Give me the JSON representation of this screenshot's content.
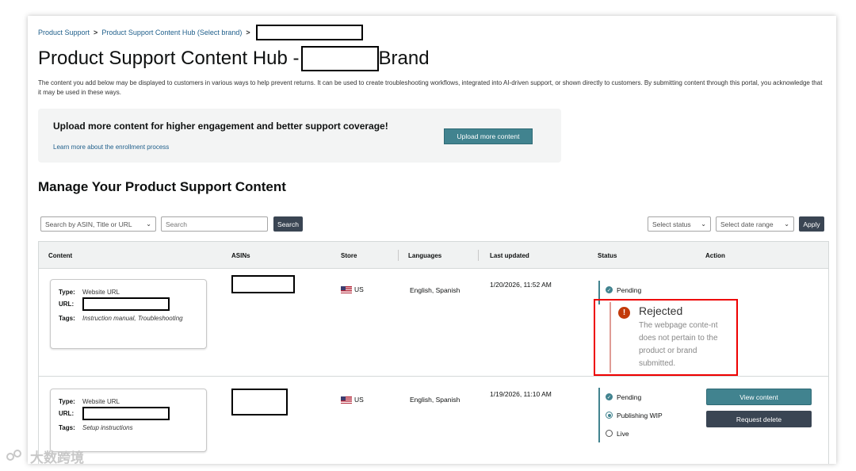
{
  "breadcrumb": {
    "items": [
      "Product Support",
      "Product Support Content Hub (Select brand)"
    ],
    "separator": ">"
  },
  "page": {
    "title_prefix": "Product Support Content Hub -",
    "title_suffix": "Brand",
    "intro": "The content you add below may be displayed to customers in various ways to help prevent returns. It can be used to create troubleshooting workflows, integrated into AI-driven support, or shown directly to customers. By submitting content through this portal, you acknowledge that it may be used in these ways."
  },
  "banner": {
    "heading": "Upload more content for higher engagement and better support coverage!",
    "learn_link": "Learn more about the enrollment process",
    "upload_button": "Upload more content"
  },
  "section": {
    "title": "Manage Your Product Support Content"
  },
  "filters": {
    "search_by": "Search by ASIN, Title or URL",
    "search_placeholder": "Search",
    "search_button": "Search",
    "status_select": "Select status",
    "date_select": "Select date range",
    "apply_button": "Apply"
  },
  "table": {
    "headers": [
      "Content",
      "ASINs",
      "Store",
      "Languages",
      "Last updated",
      "Status",
      "Action"
    ],
    "rows": [
      {
        "type_label": "Type:",
        "type": "Website URL",
        "url_label": "URL:",
        "tags_label": "Tags:",
        "tags": "Instruction manual, Troubleshooting",
        "store": "US",
        "languages": "English, Spanish",
        "updated": "1/20/2026, 11:52 AM",
        "status": [
          "Pending"
        ],
        "rejected_title": "Rejected",
        "rejected_msg": "The webpage conte-nt does not pertain to the product or brand submitted."
      },
      {
        "type_label": "Type:",
        "type": "Website URL",
        "url_label": "URL:",
        "tags_label": "Tags:",
        "tags": "Setup instructions",
        "store": "US",
        "languages": "English, Spanish",
        "updated": "1/19/2026, 11:10 AM",
        "status": [
          "Pending",
          "Publishing WIP",
          "Live"
        ],
        "actions": [
          "View content",
          "Request delete"
        ]
      }
    ]
  },
  "watermark": "大数跨境",
  "colors": {
    "teal": "#41838f",
    "dark_button": "#3a4553",
    "link": "#1f5f8b",
    "rejected_box": "#ee0000",
    "error_icon": "#c23a0a"
  }
}
